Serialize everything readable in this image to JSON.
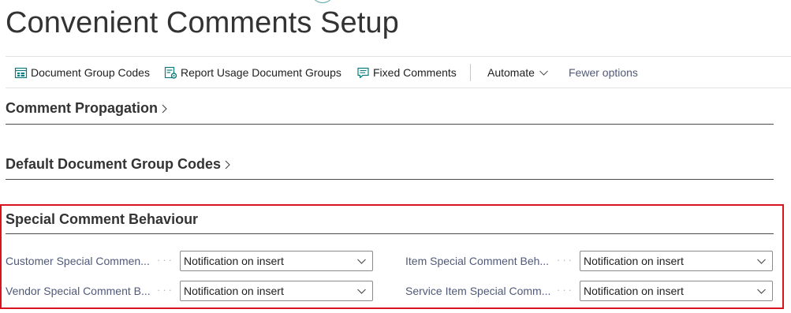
{
  "page": {
    "title": "Convenient Comments Setup"
  },
  "actions": {
    "document_group_codes": "Document Group Codes",
    "report_usage_document_groups": "Report Usage Document Groups",
    "fixed_comments": "Fixed Comments",
    "automate": "Automate",
    "fewer_options": "Fewer options",
    "icons": {
      "document_group_codes": "list-grid-icon",
      "report_usage_document_groups": "report-settings-icon",
      "fixed_comments": "comment-icon",
      "automate": "chevron-down-icon"
    }
  },
  "fasttabs": {
    "comment_propagation": "Comment Propagation",
    "default_document_group_codes": "Default Document Group Codes",
    "special_comment_behaviour": "Special Comment Behaviour"
  },
  "fields": {
    "customer": {
      "label": "Customer Special Commen...",
      "dots": "···",
      "value": "Notification on insert"
    },
    "vendor": {
      "label": "Vendor Special Comment B...",
      "dots": "···",
      "value": "Notification on insert"
    },
    "item": {
      "label": "Item Special Comment Beh...",
      "dots": "···",
      "value": "Notification on insert"
    },
    "service_item": {
      "label": "Service Item Special Comm...",
      "dots": "···",
      "value": "Notification on insert"
    }
  },
  "colors": {
    "accent_teal": "#0f7b7b",
    "highlight_red": "#d9141e",
    "label_text": "#505a78"
  }
}
